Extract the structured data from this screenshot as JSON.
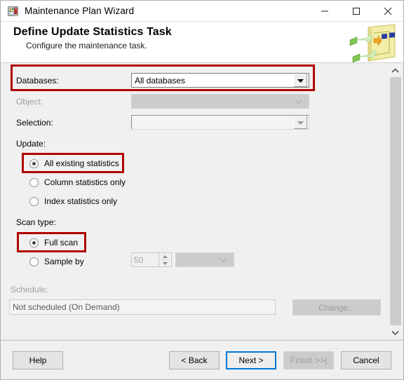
{
  "window": {
    "title": "Maintenance Plan Wizard",
    "icon": "maintenance-plan-icon",
    "controls": {
      "minimize": "minimize-icon",
      "maximize": "maximize-icon",
      "close": "close-icon"
    }
  },
  "header": {
    "title": "Define Update Statistics Task",
    "subtitle": "Configure the maintenance task.",
    "art": "update-statistics-illustration"
  },
  "form": {
    "databases": {
      "label": "Databases:",
      "value": "All databases",
      "enabled": true,
      "highlighted": true
    },
    "object": {
      "label": "Object:",
      "value": "",
      "enabled": false
    },
    "selection": {
      "label": "Selection:",
      "value": "",
      "enabled": false
    },
    "update": {
      "label": "Update:",
      "options": [
        {
          "label": "All existing statistics",
          "selected": true,
          "highlighted": true
        },
        {
          "label": "Column statistics only",
          "selected": false,
          "highlighted": false
        },
        {
          "label": "Index statistics only",
          "selected": false,
          "highlighted": false
        }
      ]
    },
    "scan_type": {
      "label": "Scan type:",
      "options": [
        {
          "label": "Full scan",
          "selected": true,
          "highlighted": true
        },
        {
          "label": "Sample by",
          "selected": false,
          "highlighted": false
        }
      ],
      "sample_value": "50",
      "sample_unit": ""
    },
    "schedule": {
      "label": "Schedule:",
      "value": "Not scheduled (On Demand)",
      "change_button": "Change..."
    }
  },
  "footer": {
    "help": "Help",
    "back": "< Back",
    "next": "Next >",
    "finish": "Finish >>|",
    "cancel": "Cancel"
  },
  "scrollbar": {
    "up": "scroll-up-icon",
    "down": "scroll-down-icon"
  },
  "colors": {
    "annotation": "#b00000",
    "focus": "#0078d7",
    "window_bg": "#f0f0f0"
  }
}
